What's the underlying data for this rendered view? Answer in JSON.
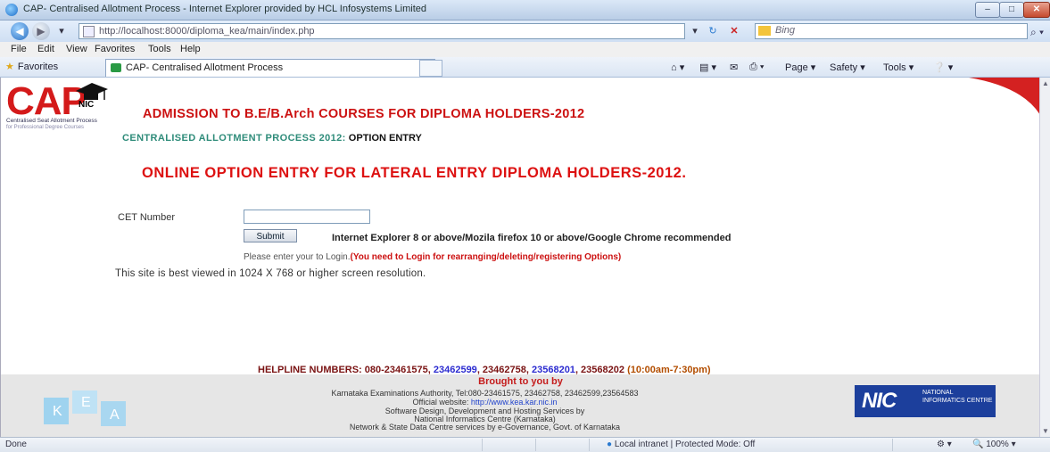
{
  "window": {
    "title": "CAP- Centralised Allotment Process - Internet Explorer provided by HCL Infosystems Limited",
    "controls": {
      "minimize": "–",
      "maximize": "□",
      "close": "✕"
    }
  },
  "addressbar": {
    "url": "http://localhost:8000/diploma_kea/main/index.php",
    "search_engine": "Bing"
  },
  "menu": [
    "File",
    "Edit",
    "View",
    "Favorites",
    "Tools",
    "Help"
  ],
  "favorites_bar": {
    "favorites_label": "Favorites",
    "tab_title": "CAP- Centralised Allotment Process"
  },
  "command_bar": {
    "page": "Page ▾",
    "safety": "Safety ▾",
    "tools": "Tools ▾"
  },
  "page": {
    "logo": {
      "cap": "CAP",
      "nic": "NIC",
      "subtitle1": "Centralised Seat Allotment Process",
      "subtitle2": "for Professional Degree Courses"
    },
    "admission_heading": "ADMISSION TO B.E/B.Arch COURSES FOR DIPLOMA HOLDERS-2012",
    "cap_line_prefix": "CENTRALISED ALLOTMENT PROCESS 2012:",
    "cap_line_suffix": "OPTION ENTRY",
    "online_heading": "ONLINE OPTION ENTRY FOR LATERAL ENTRY DIPLOMA HOLDERS-2012.",
    "form": {
      "cet_label": "CET Number",
      "cet_value": "",
      "submit_label": "Submit"
    },
    "browser_note": "Internet Explorer 8 or above/Mozila firefox 10 or above/Google Chrome recommended",
    "login_note_prefix": "Please enter your to Login.",
    "login_note_red": "(You need to Login for rearranging/deleting/registering Options)",
    "best_viewed": "This site is best viewed in 1024 X 768 or higher screen resolution.",
    "helpline": {
      "label": "HELPLINE NUMBERS: 080-",
      "n1": "23461575, ",
      "n2": "23462599",
      "n3": ", 23462758, ",
      "n4": "23568201",
      "n5": ", 23568202 ",
      "hours": "(10:00am-7:30pm)"
    }
  },
  "footer": {
    "brought": "Brought to you by",
    "line1": "Karnataka Examinations Authority, Tel:080-23461575, 23462758, 23462599,23564583",
    "line2_prefix": "Official website: ",
    "line2_link": "http://www.kea.kar.nic.in",
    "line3": "Software Design, Development and Hosting Services by",
    "line4": "National Informatics Centre (Karnataka)",
    "line5": "Network & State Data Centre services by e-Governance, Govt. of Karnataka",
    "kea_logo": "KEA",
    "nic_logo": "NIC",
    "nic_logo_sub": "NATIONAL INFORMATICS CENTRE"
  },
  "statusbar": {
    "left": "Done",
    "zone": "Local intranet | Protected Mode: Off",
    "zoom": "100%"
  }
}
